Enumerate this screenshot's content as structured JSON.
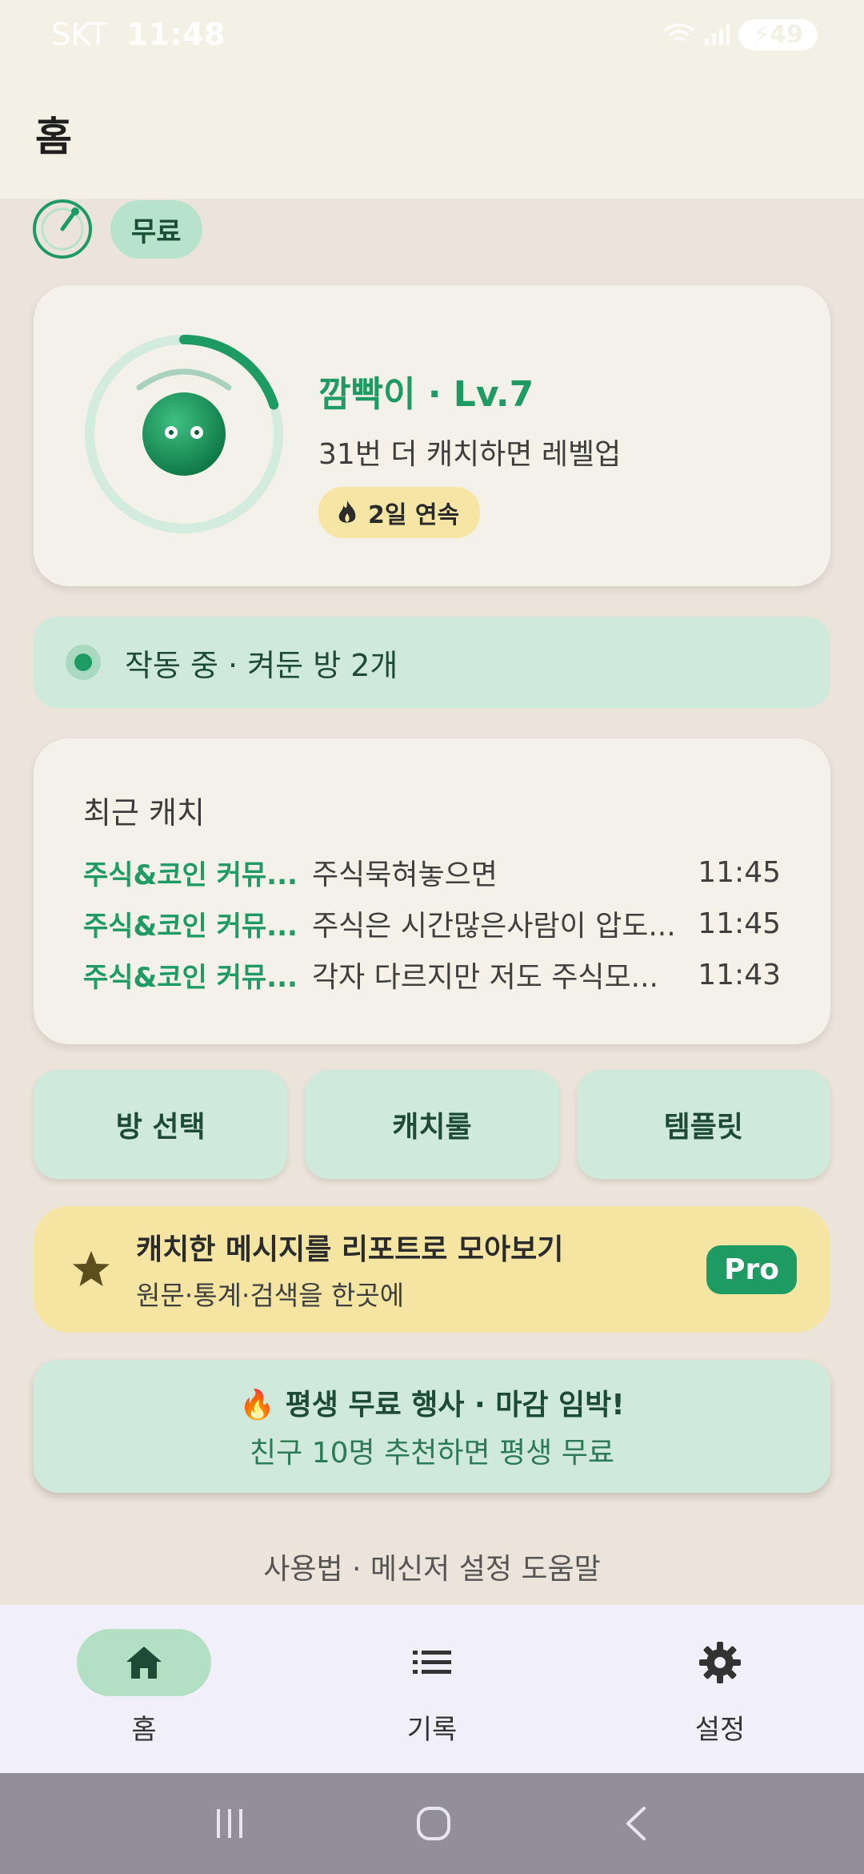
{
  "status_bar": {
    "carrier": "SKT",
    "time": "11:48",
    "battery": "49"
  },
  "app_bar": {
    "title": "홈"
  },
  "plan": {
    "chip_label": "무료"
  },
  "profile": {
    "name": "깜빡이 · Lv.7",
    "levelup_hint": "31번 더 캐치하면 레벨업",
    "streak": "2일 연속",
    "level_progress": 0.2
  },
  "running": {
    "text": "작동 중 · 켜둔 방 2개"
  },
  "recent": {
    "title": "최근 캐치",
    "items": [
      {
        "room": "주식&코인 커뮤...",
        "message": "주식묵혀놓으면",
        "time": "11:45"
      },
      {
        "room": "주식&코인 커뮤...",
        "message": "주식은 시간많은사람이 압도...",
        "time": "11:45"
      },
      {
        "room": "주식&코인 커뮤...",
        "message": "각자 다르지만 저도 주식모...",
        "time": "11:43"
      }
    ]
  },
  "actions": {
    "room_select": "방 선택",
    "catch_rules": "캐치룰",
    "templates": "템플릿"
  },
  "pro_banner": {
    "title": "캐치한 메시지를 리포트로 모아보기",
    "subtitle": "원문·통계·검색을 한곳에",
    "badge": "Pro"
  },
  "event_banner": {
    "title": "🔥 평생 무료 행사 · 마감 임박!",
    "subtitle": "친구 10명 추천하면 평생 무료"
  },
  "help_link": "사용법 · 메신저 설정 도움말",
  "bottom_nav": {
    "home": "홈",
    "history": "기록",
    "settings": "설정"
  },
  "colors": {
    "accent": "#1e9a63",
    "background": "#ebe4da",
    "card": "#f4f1e8",
    "mint": "#cfe9dc",
    "yellow": "#f5e5a2"
  }
}
